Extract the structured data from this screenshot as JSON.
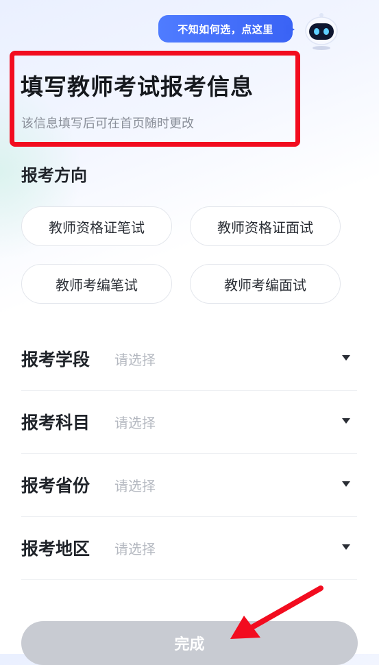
{
  "assistant": {
    "bubble_text": "不知如何选，点这里",
    "icon": "robot-icon"
  },
  "header": {
    "title": "填写教师考试报考信息",
    "subtitle": "该信息填写后可在首页随时更改"
  },
  "direction": {
    "label": "报考方向",
    "options": [
      "教师资格证笔试",
      "教师资格证面试",
      "教师考编笔试",
      "教师考编面试"
    ]
  },
  "fields": [
    {
      "label": "报考学段",
      "placeholder": "请选择"
    },
    {
      "label": "报考科目",
      "placeholder": "请选择"
    },
    {
      "label": "报考省份",
      "placeholder": "请选择"
    },
    {
      "label": "报考地区",
      "placeholder": "请选择"
    }
  ],
  "footer": {
    "done_label": "完成"
  },
  "colors": {
    "accent": "#3a63f5",
    "annotation_red": "#f20c1f",
    "button_disabled": "#c8cbd2"
  }
}
